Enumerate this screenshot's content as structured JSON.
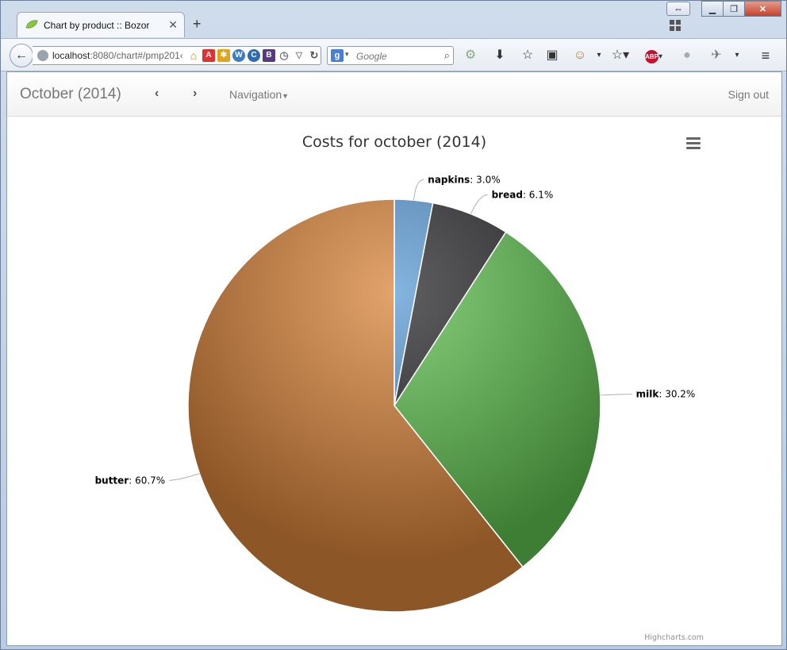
{
  "browser": {
    "tab_title": "Chart by product :: Bozor",
    "new_tab": "+",
    "url_host": "localhost",
    "url_rest": ":8080/chart#/pmp201‹",
    "search_placeholder": "Google"
  },
  "navbar": {
    "brand": "October (2014)",
    "navigation_label": "Navigation",
    "signout_label": "Sign out"
  },
  "chart_data": {
    "type": "pie",
    "title": "Costs for october (2014)",
    "credits": "Highcharts.com",
    "slices": [
      {
        "name": "napkins",
        "value": 3.0,
        "label": ": 3.0%",
        "color": "#5b9bd5"
      },
      {
        "name": "bread",
        "value": 6.1,
        "label": ": 6.1%",
        "color": "#2b2b2e"
      },
      {
        "name": "milk",
        "value": 30.2,
        "label": ": 30.2%",
        "color": "#5fc150"
      },
      {
        "name": "butter",
        "value": 60.7,
        "label": ": 60.7%",
        "color": "#d9843a"
      }
    ]
  }
}
